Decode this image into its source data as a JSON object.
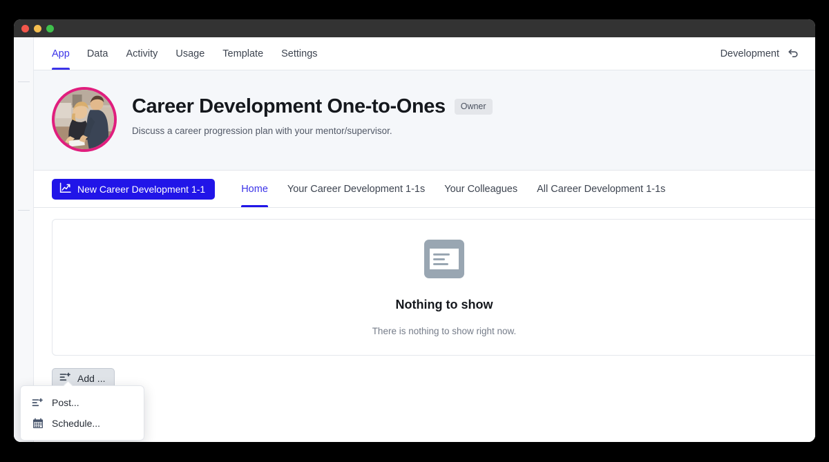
{
  "window": {
    "traffic_lights": [
      "close",
      "minimize",
      "maximize"
    ]
  },
  "topnav": {
    "items": [
      {
        "label": "App",
        "active": true
      },
      {
        "label": "Data",
        "active": false
      },
      {
        "label": "Activity",
        "active": false
      },
      {
        "label": "Usage",
        "active": false
      },
      {
        "label": "Template",
        "active": false
      },
      {
        "label": "Settings",
        "active": false
      }
    ],
    "environment_label": "Development",
    "undo_icon": "undo-arrow-icon"
  },
  "app_header": {
    "title": "Career Development One-to-Ones",
    "badge": "Owner",
    "subtitle": "Discuss a career progression plan with your mentor/supervisor.",
    "avatar_icon": "app-avatar-photo",
    "avatar_ring_color": "#E01E7E"
  },
  "subnav": {
    "primary_button": {
      "label": "New Career Development 1-1",
      "icon": "line-chart-up-icon",
      "color": "#2115E8"
    },
    "tabs": [
      {
        "label": "Home",
        "active": true
      },
      {
        "label": "Your Career Development 1-1s",
        "active": false
      },
      {
        "label": "Your Colleagues",
        "active": false
      },
      {
        "label": "All Career Development 1-1s",
        "active": false
      }
    ]
  },
  "main": {
    "empty_state": {
      "icon": "document-placeholder-icon",
      "title": "Nothing to show",
      "subtitle": "There is nothing to show right now."
    },
    "add_button": {
      "label": "Add ...",
      "icon": "list-plus-icon"
    }
  },
  "popover": {
    "items": [
      {
        "label": "Post...",
        "icon": "list-plus-icon"
      },
      {
        "label": "Schedule...",
        "icon": "calendar-icon"
      }
    ]
  }
}
